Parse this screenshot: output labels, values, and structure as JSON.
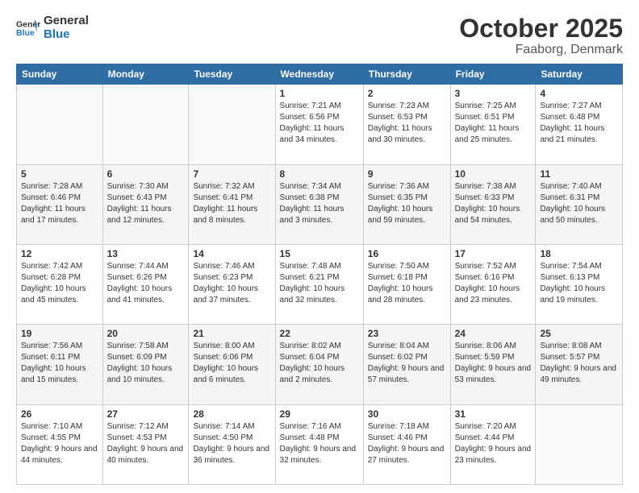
{
  "header": {
    "logo_line1": "General",
    "logo_line2": "Blue",
    "month": "October 2025",
    "location": "Faaborg, Denmark"
  },
  "days_of_week": [
    "Sunday",
    "Monday",
    "Tuesday",
    "Wednesday",
    "Thursday",
    "Friday",
    "Saturday"
  ],
  "weeks": [
    [
      {
        "num": "",
        "info": ""
      },
      {
        "num": "",
        "info": ""
      },
      {
        "num": "",
        "info": ""
      },
      {
        "num": "1",
        "info": "Sunrise: 7:21 AM\nSunset: 6:56 PM\nDaylight: 11 hours and 34 minutes."
      },
      {
        "num": "2",
        "info": "Sunrise: 7:23 AM\nSunset: 6:53 PM\nDaylight: 11 hours and 30 minutes."
      },
      {
        "num": "3",
        "info": "Sunrise: 7:25 AM\nSunset: 6:51 PM\nDaylight: 11 hours and 25 minutes."
      },
      {
        "num": "4",
        "info": "Sunrise: 7:27 AM\nSunset: 6:48 PM\nDaylight: 11 hours and 21 minutes."
      }
    ],
    [
      {
        "num": "5",
        "info": "Sunrise: 7:28 AM\nSunset: 6:46 PM\nDaylight: 11 hours and 17 minutes."
      },
      {
        "num": "6",
        "info": "Sunrise: 7:30 AM\nSunset: 6:43 PM\nDaylight: 11 hours and 12 minutes."
      },
      {
        "num": "7",
        "info": "Sunrise: 7:32 AM\nSunset: 6:41 PM\nDaylight: 11 hours and 8 minutes."
      },
      {
        "num": "8",
        "info": "Sunrise: 7:34 AM\nSunset: 6:38 PM\nDaylight: 11 hours and 3 minutes."
      },
      {
        "num": "9",
        "info": "Sunrise: 7:36 AM\nSunset: 6:35 PM\nDaylight: 10 hours and 59 minutes."
      },
      {
        "num": "10",
        "info": "Sunrise: 7:38 AM\nSunset: 6:33 PM\nDaylight: 10 hours and 54 minutes."
      },
      {
        "num": "11",
        "info": "Sunrise: 7:40 AM\nSunset: 6:31 PM\nDaylight: 10 hours and 50 minutes."
      }
    ],
    [
      {
        "num": "12",
        "info": "Sunrise: 7:42 AM\nSunset: 6:28 PM\nDaylight: 10 hours and 45 minutes."
      },
      {
        "num": "13",
        "info": "Sunrise: 7:44 AM\nSunset: 6:26 PM\nDaylight: 10 hours and 41 minutes."
      },
      {
        "num": "14",
        "info": "Sunrise: 7:46 AM\nSunset: 6:23 PM\nDaylight: 10 hours and 37 minutes."
      },
      {
        "num": "15",
        "info": "Sunrise: 7:48 AM\nSunset: 6:21 PM\nDaylight: 10 hours and 32 minutes."
      },
      {
        "num": "16",
        "info": "Sunrise: 7:50 AM\nSunset: 6:18 PM\nDaylight: 10 hours and 28 minutes."
      },
      {
        "num": "17",
        "info": "Sunrise: 7:52 AM\nSunset: 6:16 PM\nDaylight: 10 hours and 23 minutes."
      },
      {
        "num": "18",
        "info": "Sunrise: 7:54 AM\nSunset: 6:13 PM\nDaylight: 10 hours and 19 minutes."
      }
    ],
    [
      {
        "num": "19",
        "info": "Sunrise: 7:56 AM\nSunset: 6:11 PM\nDaylight: 10 hours and 15 minutes."
      },
      {
        "num": "20",
        "info": "Sunrise: 7:58 AM\nSunset: 6:09 PM\nDaylight: 10 hours and 10 minutes."
      },
      {
        "num": "21",
        "info": "Sunrise: 8:00 AM\nSunset: 6:06 PM\nDaylight: 10 hours and 6 minutes."
      },
      {
        "num": "22",
        "info": "Sunrise: 8:02 AM\nSunset: 6:04 PM\nDaylight: 10 hours and 2 minutes."
      },
      {
        "num": "23",
        "info": "Sunrise: 8:04 AM\nSunset: 6:02 PM\nDaylight: 9 hours and 57 minutes."
      },
      {
        "num": "24",
        "info": "Sunrise: 8:06 AM\nSunset: 5:59 PM\nDaylight: 9 hours and 53 minutes."
      },
      {
        "num": "25",
        "info": "Sunrise: 8:08 AM\nSunset: 5:57 PM\nDaylight: 9 hours and 49 minutes."
      }
    ],
    [
      {
        "num": "26",
        "info": "Sunrise: 7:10 AM\nSunset: 4:55 PM\nDaylight: 9 hours and 44 minutes."
      },
      {
        "num": "27",
        "info": "Sunrise: 7:12 AM\nSunset: 4:53 PM\nDaylight: 9 hours and 40 minutes."
      },
      {
        "num": "28",
        "info": "Sunrise: 7:14 AM\nSunset: 4:50 PM\nDaylight: 9 hours and 36 minutes."
      },
      {
        "num": "29",
        "info": "Sunrise: 7:16 AM\nSunset: 4:48 PM\nDaylight: 9 hours and 32 minutes."
      },
      {
        "num": "30",
        "info": "Sunrise: 7:18 AM\nSunset: 4:46 PM\nDaylight: 9 hours and 27 minutes."
      },
      {
        "num": "31",
        "info": "Sunrise: 7:20 AM\nSunset: 4:44 PM\nDaylight: 9 hours and 23 minutes."
      },
      {
        "num": "",
        "info": ""
      }
    ]
  ]
}
